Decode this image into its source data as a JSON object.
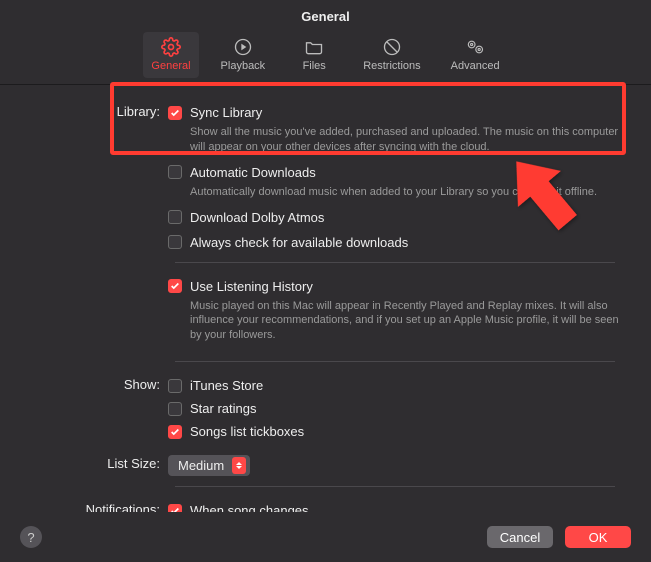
{
  "window": {
    "title": "General"
  },
  "toolbar": {
    "general": "General",
    "playback": "Playback",
    "files": "Files",
    "restrictions": "Restrictions",
    "advanced": "Advanced"
  },
  "labels": {
    "library": "Library:",
    "show": "Show:",
    "list_size": "List Size:",
    "notifications": "Notifications:"
  },
  "library": {
    "sync": {
      "label": "Sync Library",
      "desc": "Show all the music you've added, purchased and uploaded. The music on this computer will appear on your other devices after syncing with the cloud."
    },
    "auto_dl": {
      "label": "Automatic Downloads",
      "desc": "Automatically download music when added to your Library so you can play it offline."
    },
    "dolby": {
      "label": "Download Dolby Atmos"
    },
    "always_check": {
      "label": "Always check for available downloads"
    },
    "history": {
      "label": "Use Listening History",
      "desc": "Music played on this Mac will appear in Recently Played and Replay mixes. It will also influence your recommendations, and if you set up an Apple Music profile, it will be seen by your followers."
    }
  },
  "show": {
    "itunes": "iTunes Store",
    "star": "Star ratings",
    "tickboxes": "Songs list tickboxes"
  },
  "list_size": {
    "value": "Medium"
  },
  "notifications": {
    "song_changes": "When song changes"
  },
  "footer": {
    "help": "?",
    "cancel": "Cancel",
    "ok": "OK"
  }
}
